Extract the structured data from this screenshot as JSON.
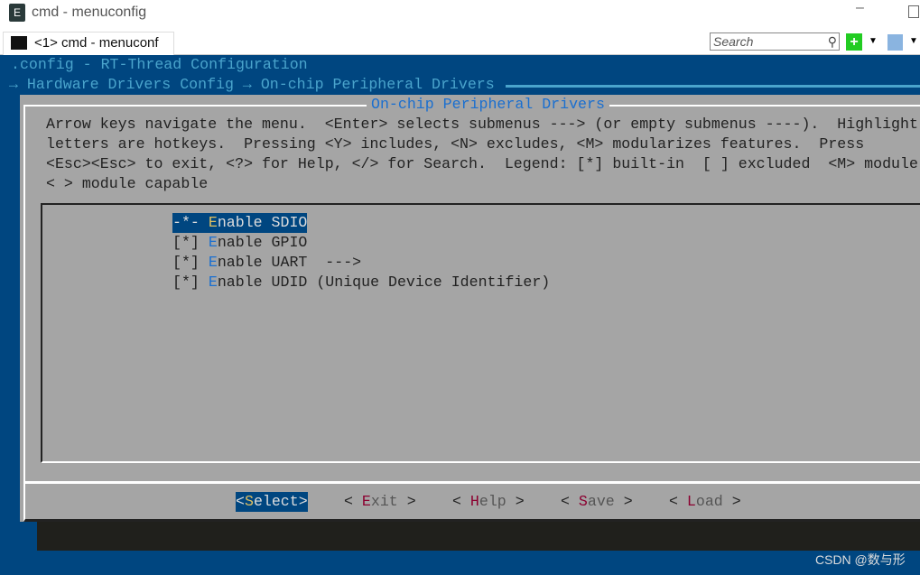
{
  "window": {
    "title": "cmd - menuconfig",
    "tab_label": "<1> cmd - menuconf",
    "search_placeholder": "Search"
  },
  "terminal": {
    "config_title": ".config - RT-Thread Configuration",
    "breadcrumb": "→ Hardware Drivers Config → On-chip Peripheral Drivers",
    "dialog_title": "On-chip Peripheral Drivers",
    "help_lines": [
      "Arrow keys navigate the menu.  <Enter> selects submenus ---> (or empty submenus ----).  Highlight",
      "letters are hotkeys.  Pressing <Y> includes, <N> excludes, <M> modularizes features.  Press",
      "<Esc><Esc> to exit, <?> for Help, </> for Search.  Legend: [*] built-in  [ ] excluded  <M> module",
      "< > module capable"
    ],
    "items": [
      {
        "prefix": "-*-",
        "hotkey": "E",
        "rest": "nable SDIO",
        "selected": true
      },
      {
        "prefix": "[*]",
        "hotkey": "E",
        "rest": "nable GPIO"
      },
      {
        "prefix": "[*]",
        "hotkey": "E",
        "rest": "nable UART  --->"
      },
      {
        "prefix": "[*]",
        "hotkey": "E",
        "rest": "nable UDID (Unique Device Identifier)"
      }
    ],
    "buttons": [
      {
        "pre": "<",
        "hotkey": "S",
        "rest": "elect",
        "post": ">",
        "selected": true
      },
      {
        "pre": "< ",
        "hotkey": "E",
        "rest": "xit",
        "post": " >"
      },
      {
        "pre": "< ",
        "hotkey": "H",
        "rest": "elp",
        "post": " >"
      },
      {
        "pre": "< ",
        "hotkey": "S",
        "rest": "ave",
        "post": " >"
      },
      {
        "pre": "< ",
        "hotkey": "L",
        "rest": "oad",
        "post": " >"
      }
    ]
  },
  "watermark": "CSDN @数与形",
  "colors": {
    "terminal_bg": "#004680",
    "dialog_bg": "#a5a5a5",
    "hotkey": "#1a6fd0",
    "button_hotkey": "#8b0030"
  }
}
